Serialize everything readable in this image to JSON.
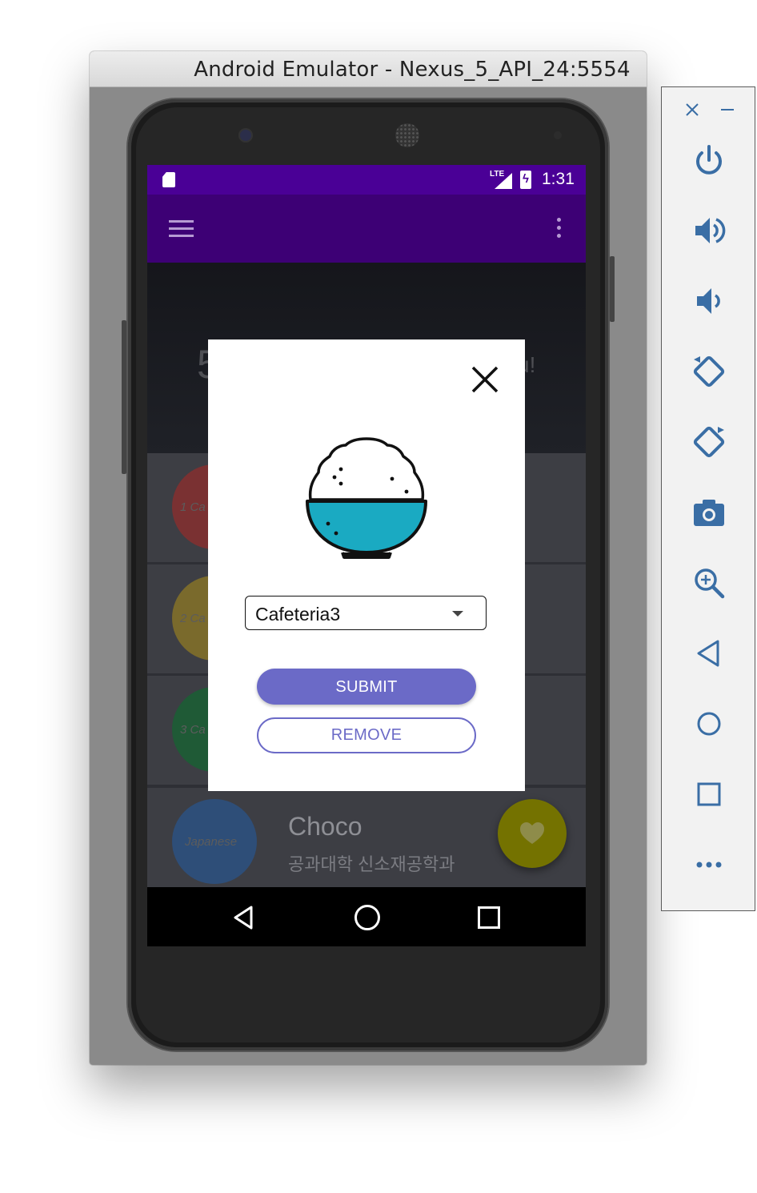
{
  "window": {
    "title": "Android Emulator - Nexus_5_API_24:5554"
  },
  "status_bar": {
    "network": "LTE",
    "time": "1:31"
  },
  "hero": {
    "count_fragment": "5",
    "text_fragment": "u!"
  },
  "list": [
    {
      "badge": "1 Ca",
      "color": "#7a3132"
    },
    {
      "badge": "2 Ca",
      "color": "#7a6a2c"
    },
    {
      "badge": "3 Ca",
      "color": "#1f5a36"
    },
    {
      "badge": "Japanese",
      "color": "#2e4e78",
      "name": "Choco",
      "subtitle": "공과대학 신소재공학과"
    }
  ],
  "dialog": {
    "cafeteria_selected": "Cafeteria3",
    "submit_label": "SUBMIT",
    "remove_label": "REMOVE",
    "icon": "rice-bowl-icon"
  },
  "toolbar": {
    "buttons": [
      "close-icon",
      "minimize-icon",
      "power-icon",
      "volume-up-icon",
      "volume-down-icon",
      "rotate-left-icon",
      "rotate-right-icon",
      "camera-icon",
      "zoom-icon",
      "back-icon",
      "home-icon",
      "overview-icon",
      "more-icon"
    ]
  },
  "colors": {
    "status_bar": "#4a0096",
    "app_bar": "#3d0075",
    "accent": "#6b6ac7",
    "rice_bowl": "#1aaac2",
    "fab": "#747200"
  }
}
